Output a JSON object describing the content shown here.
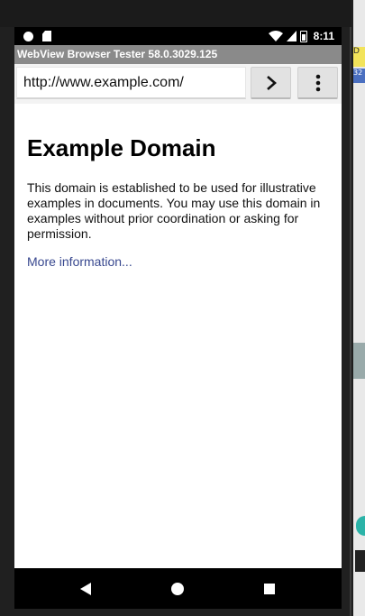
{
  "status_bar": {
    "time": "8:11",
    "icons": [
      "notification-dot-icon",
      "sd-card-icon",
      "wifi-icon",
      "signal-icon",
      "battery-icon"
    ]
  },
  "app": {
    "title": "WebView Browser Tester 58.0.3029.125"
  },
  "toolbar": {
    "url_value": "http://www.example.com/",
    "go_icon": "chevron-right-icon",
    "menu_icon": "more-vert-icon"
  },
  "page": {
    "heading": "Example Domain",
    "paragraph": "This domain is established to be used for illustrative examples in documents. You may use this domain in examples without prior coordination or asking for permission.",
    "link_text": "More information...",
    "link_color": "#38488f"
  },
  "nav_bar": {
    "icons": [
      "back-icon",
      "home-icon",
      "recents-icon"
    ]
  },
  "side_strip": {
    "yellow_text": "D",
    "blue_text": "32",
    "partial_text": "D"
  }
}
